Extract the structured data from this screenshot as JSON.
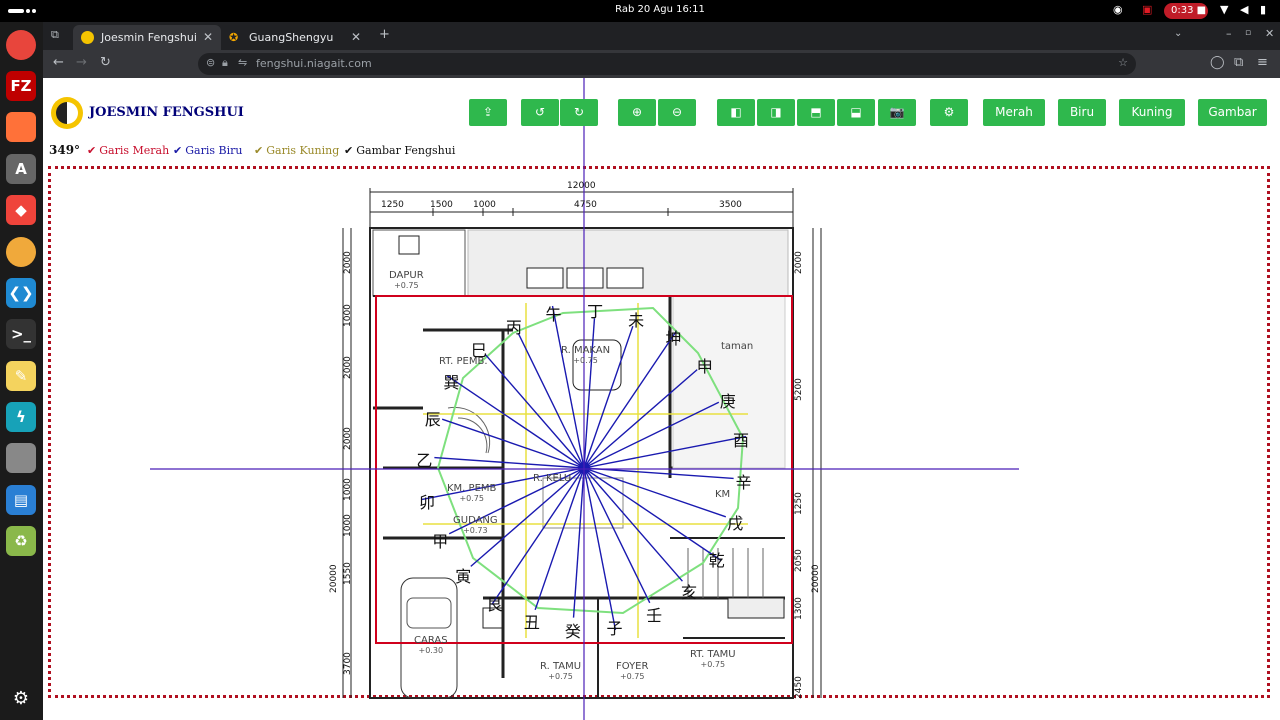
{
  "system": {
    "clock": "Rab 20 Agu  16:11",
    "recording_time": "0:33"
  },
  "dock": {
    "apps": [
      {
        "name": "chrome",
        "color": "#e8453c"
      },
      {
        "name": "filezilla",
        "color": "#bf0000",
        "glyph": "FZ"
      },
      {
        "name": "firefox",
        "color": "#ff7139"
      },
      {
        "name": "software",
        "color": "#666666",
        "glyph": "A"
      },
      {
        "name": "anydesk",
        "color": "#ef443b",
        "glyph": "◆"
      },
      {
        "name": "chrome-canary",
        "color": "#f0a93b"
      },
      {
        "name": "vscode",
        "color": "#1f8ad2",
        "glyph": "❮❯"
      },
      {
        "name": "terminal",
        "color": "#333333",
        "glyph": ">_"
      },
      {
        "name": "text-editor",
        "color": "#f4d35e",
        "glyph": "✎"
      },
      {
        "name": "bolt-app",
        "color": "#17a2b8",
        "glyph": "ϟ"
      },
      {
        "name": "files",
        "color": "#888888"
      },
      {
        "name": "writer",
        "color": "#2a7fd4",
        "glyph": "▤"
      },
      {
        "name": "trash",
        "color": "#8ab84a",
        "glyph": "♻"
      }
    ],
    "badge": "1"
  },
  "browser": {
    "tabs": [
      {
        "label": "Joesmin Fengshui",
        "active": true
      },
      {
        "label": "GuangShengyu",
        "active": false
      }
    ],
    "url": "fengshui.niagait.com"
  },
  "app": {
    "title": "JOESMIN FENGSHUI",
    "toolbar_buttons": [
      {
        "icon": "upload-icon",
        "glyph": "⇪"
      },
      {
        "icon": "rotate-left-icon",
        "glyph": "↺"
      },
      {
        "icon": "rotate-right-icon",
        "glyph": "↻"
      },
      {
        "icon": "zoom-in-icon",
        "glyph": "⊕"
      },
      {
        "icon": "zoom-out-icon",
        "glyph": "⊖"
      },
      {
        "icon": "move-left-icon",
        "glyph": "◧"
      },
      {
        "icon": "move-right-icon",
        "glyph": "◨"
      },
      {
        "icon": "move-up-icon",
        "glyph": "⬒"
      },
      {
        "icon": "move-down-icon",
        "glyph": "⬓"
      },
      {
        "icon": "camera-icon",
        "glyph": "📷"
      },
      {
        "icon": "settings-icon",
        "glyph": "⚙"
      }
    ],
    "text_buttons": [
      "Merah",
      "Biru",
      "Kuning",
      "Gambar"
    ],
    "degree": "349°",
    "legend": [
      {
        "label": "Garis Merah",
        "color": "#c8102e"
      },
      {
        "label": "Garis Biru",
        "color": "#1a1aa6"
      },
      {
        "label": "Garis Kuning",
        "color": "#9a8a2a"
      },
      {
        "label": "Gambar Fengshui",
        "color": "#111111"
      }
    ]
  },
  "plan": {
    "top_dims": [
      "12000",
      "1250",
      "1500",
      "1000",
      "4750",
      "3500"
    ],
    "left_dims": [
      "2000",
      "1000",
      "2000",
      "2000",
      "1000",
      "1000",
      "1550",
      "3700",
      "20000"
    ],
    "right_dims": [
      "2000",
      "5200",
      "1250",
      "2050",
      "1300",
      "2450",
      "20000"
    ],
    "rooms": [
      {
        "name": "DAPUR",
        "level": "+0.75"
      },
      {
        "name": "RT. PEMB.",
        "level": ""
      },
      {
        "name": "R. MAKAN",
        "level": "+0.75"
      },
      {
        "name": "taman",
        "level": ""
      },
      {
        "name": "R. KELU",
        "level": ""
      },
      {
        "name": "KM. PEMB",
        "level": "+0.75"
      },
      {
        "name": "GUDANG",
        "level": "+0.73"
      },
      {
        "name": "KM",
        "level": ""
      },
      {
        "name": "CARAS",
        "level": "+0.30"
      },
      {
        "name": "R. TAMU",
        "level": "+0.75"
      },
      {
        "name": "FOYER",
        "level": "+0.75"
      },
      {
        "name": "RT. TAMU",
        "level": "+0.75"
      }
    ],
    "compass_labels": [
      "子",
      "癸",
      "丑",
      "艮",
      "寅",
      "甲",
      "卯",
      "乙",
      "辰",
      "巽",
      "巳",
      "丙",
      "午",
      "丁",
      "未",
      "坤",
      "申",
      "庚",
      "酉",
      "辛",
      "戌",
      "乾",
      "亥",
      "壬"
    ]
  },
  "colors": {
    "button_green": "#2fb84d",
    "red_line": "#d0001c",
    "blue_line": "#1a1ab0",
    "yellow_line": "#e8e040",
    "green_octagon": "#7ee07e",
    "crosshair": "#4b1fb8"
  }
}
